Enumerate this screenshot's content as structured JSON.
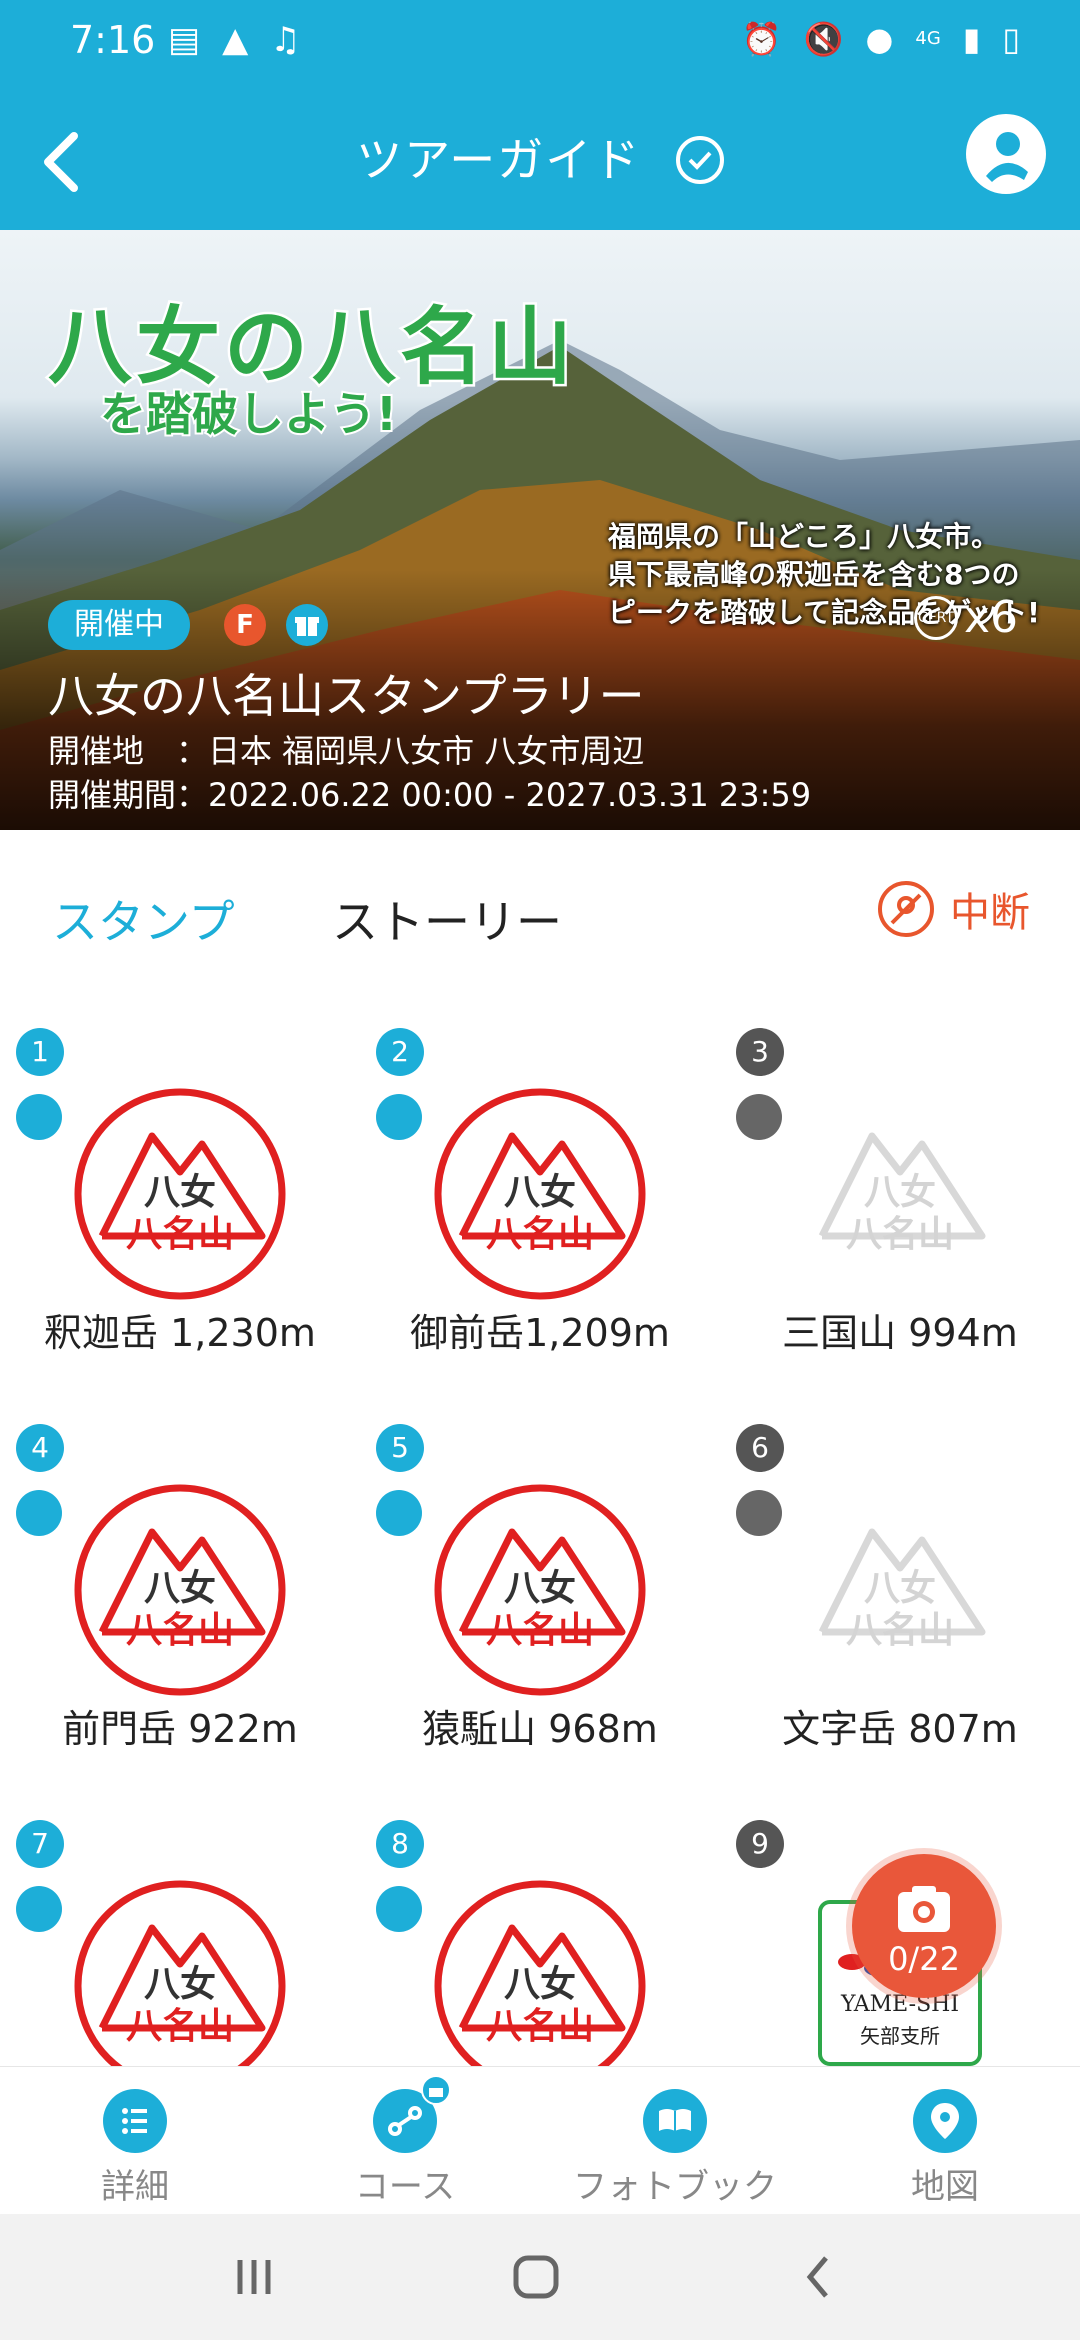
{
  "status": {
    "time": "7:16",
    "network": "4G"
  },
  "header": {
    "title": "ツアーガイド"
  },
  "banner": {
    "headline": "八女の八名山",
    "subheadline": "を踏破しよう!",
    "description": [
      "福岡県の「山どころ」八女市。",
      "県下最高峰の釈迦岳を含む8つの",
      "ピークを踏破して記念品をゲット!"
    ],
    "status_badge": "開催中",
    "f_badge": "F",
    "cert_multiplier": "x6",
    "cert_icon_text": "CERT",
    "event_title": "八女の八名山スタンプラリー",
    "venue": "開催地　：日本 福岡県八女市 八女市周辺",
    "period": "開催期間：2022.06.22 00:00 - 2027.03.31 23:59"
  },
  "tabs": {
    "stamp": "スタンプ",
    "story": "ストーリー",
    "pause": "中断"
  },
  "stamp_text": {
    "line1": "八女",
    "line2": "八名山"
  },
  "stamps": [
    {
      "num": "1",
      "label": "釈迦岳 1,230m",
      "collected": true
    },
    {
      "num": "2",
      "label": "御前岳1,209m",
      "collected": true
    },
    {
      "num": "3",
      "label": "三国山 994m",
      "collected": false
    },
    {
      "num": "4",
      "label": "前門岳 922m",
      "collected": true
    },
    {
      "num": "5",
      "label": "猿駈山 968m",
      "collected": true
    },
    {
      "num": "6",
      "label": "文字岳 807m",
      "collected": false
    },
    {
      "num": "7",
      "label": "",
      "collected": true
    },
    {
      "num": "8",
      "label": "",
      "collected": true
    },
    {
      "num": "9",
      "label": "",
      "collected": false
    }
  ],
  "yame_badge": {
    "text": "YAME-SHI",
    "sub": "矢部支所"
  },
  "camera": {
    "count": "0/22"
  },
  "bottom_nav": [
    "詳細",
    "コース",
    "フォトブック",
    "地図"
  ],
  "colors": {
    "accent": "#1daed8",
    "stamp_red": "#e02020",
    "pause_orange": "#e8562d"
  }
}
